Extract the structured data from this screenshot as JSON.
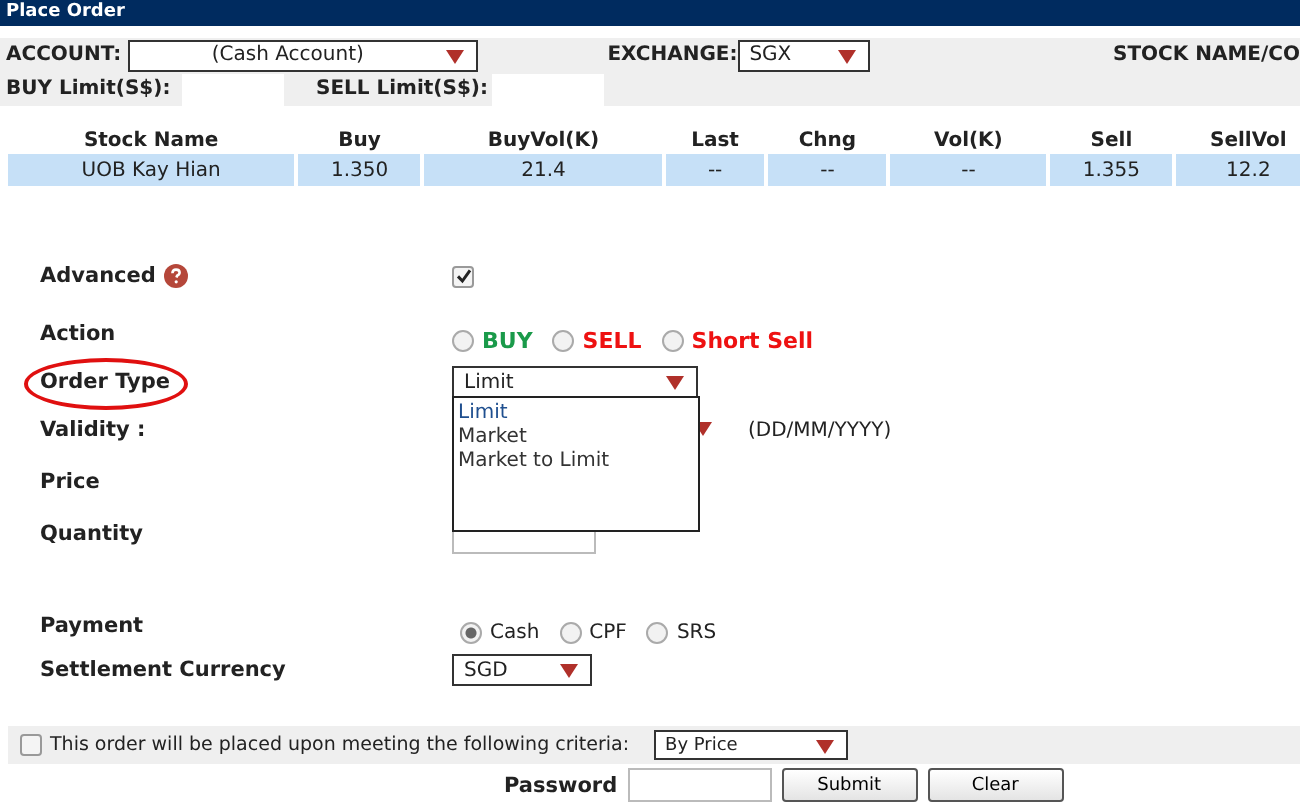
{
  "window": {
    "title": "Place Order"
  },
  "account": {
    "label": "ACCOUNT:",
    "value": "(Cash Account)"
  },
  "exchange": {
    "label": "EXCHANGE:",
    "value": "SGX"
  },
  "stock_name_label": "STOCK NAME/CO",
  "buy_limit": {
    "label": "BUY Limit(S$):"
  },
  "sell_limit": {
    "label": "SELL Limit(S$):"
  },
  "table": {
    "columns": [
      "Stock Name",
      "Buy",
      "BuyVol(K)",
      "Last",
      "Chng",
      "Vol(K)",
      "Sell",
      "SellVol"
    ],
    "rows": [
      {
        "selected": true,
        "cells": [
          "UOB Kay Hian",
          "1.350",
          "21.4",
          "--",
          "--",
          "--",
          "1.355",
          "12.2"
        ]
      }
    ]
  },
  "advanced": {
    "label": "Advanced",
    "checked": true
  },
  "action": {
    "label": "Action",
    "options": [
      {
        "label": "BUY",
        "selected": false,
        "color": "#1a9a4a"
      },
      {
        "label": "SELL",
        "selected": false,
        "color": "#ee1111"
      },
      {
        "label": "Short Sell",
        "selected": false,
        "color": "#ee1111"
      }
    ]
  },
  "order_type": {
    "label": "Order Type",
    "value": "Limit",
    "expanded": true,
    "highlighted": true,
    "options": [
      {
        "label": "Limit",
        "selected": true
      },
      {
        "label": "Market",
        "selected": false
      },
      {
        "label": "Market to Limit",
        "selected": false
      }
    ]
  },
  "validity": {
    "label": "Validity :",
    "hint": "(DD/MM/YYYY)"
  },
  "price": {
    "label": "Price"
  },
  "quantity": {
    "label": "Quantity"
  },
  "payment": {
    "label": "Payment",
    "options": [
      {
        "label": "Cash",
        "selected": true
      },
      {
        "label": "CPF",
        "selected": false
      },
      {
        "label": "SRS",
        "selected": false
      }
    ]
  },
  "settlement_currency": {
    "label": "Settlement Currency",
    "value": "SGD"
  },
  "criteria": {
    "checked": false,
    "label": "This order will be placed upon meeting the following criteria:",
    "value": "By Price"
  },
  "password": {
    "label": "Password"
  },
  "buttons": [
    "Submit",
    "Clear"
  ]
}
